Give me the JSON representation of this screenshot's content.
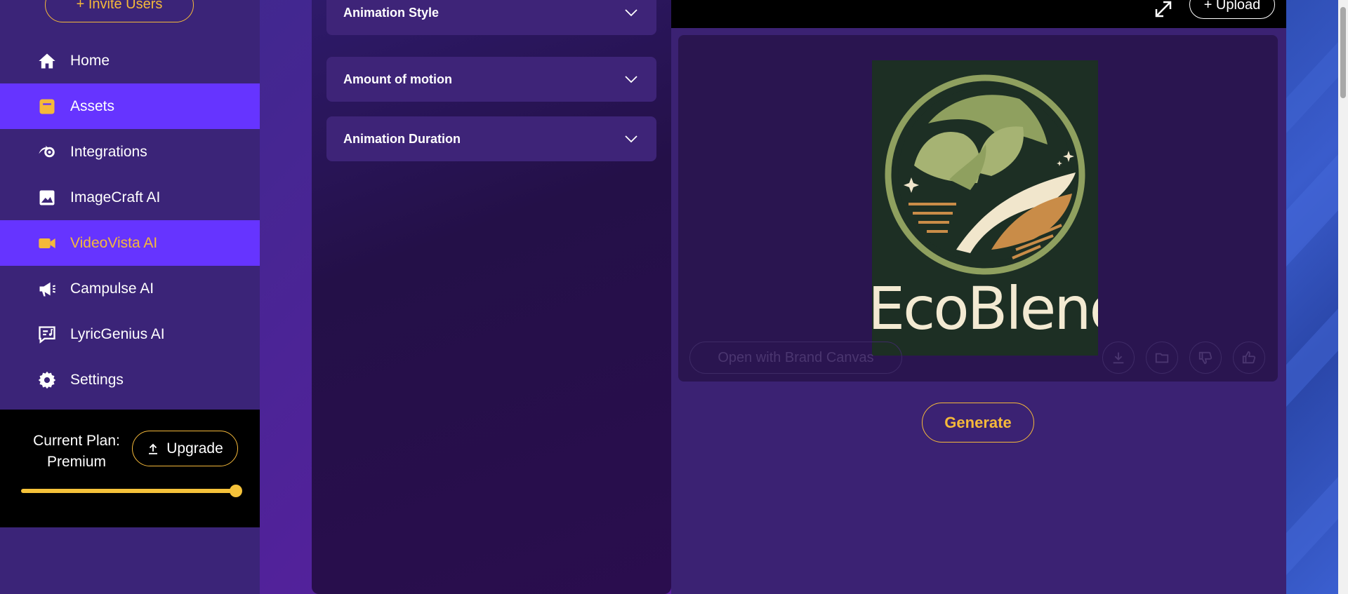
{
  "sidebar": {
    "invite_label": "+ Invite Users",
    "items": [
      {
        "label": "Home",
        "icon": "home-icon"
      },
      {
        "label": "Assets",
        "icon": "assets-icon"
      },
      {
        "label": "Integrations",
        "icon": "integrations-icon"
      },
      {
        "label": "ImageCraft AI",
        "icon": "image-icon"
      },
      {
        "label": "VideoVista AI",
        "icon": "video-icon"
      },
      {
        "label": "Campulse AI",
        "icon": "megaphone-icon"
      },
      {
        "label": "LyricGenius AI",
        "icon": "lyrics-icon"
      },
      {
        "label": "Settings",
        "icon": "gear-icon"
      }
    ],
    "plan": {
      "label_line1": "Current Plan:",
      "label_line2": "Premium",
      "upgrade_label": "Upgrade",
      "usage_fraction": 1.0
    }
  },
  "settings": {
    "accordions": [
      {
        "label": "Animation Style"
      },
      {
        "label": "Amount of motion"
      },
      {
        "label": "Animation Duration"
      }
    ]
  },
  "preview": {
    "upload_label": "+ Upload",
    "logo_text": "EcoBlend",
    "brand_canvas_label": "Open with Brand Canvas",
    "generate_label": "Generate"
  },
  "colors": {
    "accent": "#f5b93a",
    "active_nav": "#6634ff",
    "sidebar_bg": "#3b2478"
  }
}
